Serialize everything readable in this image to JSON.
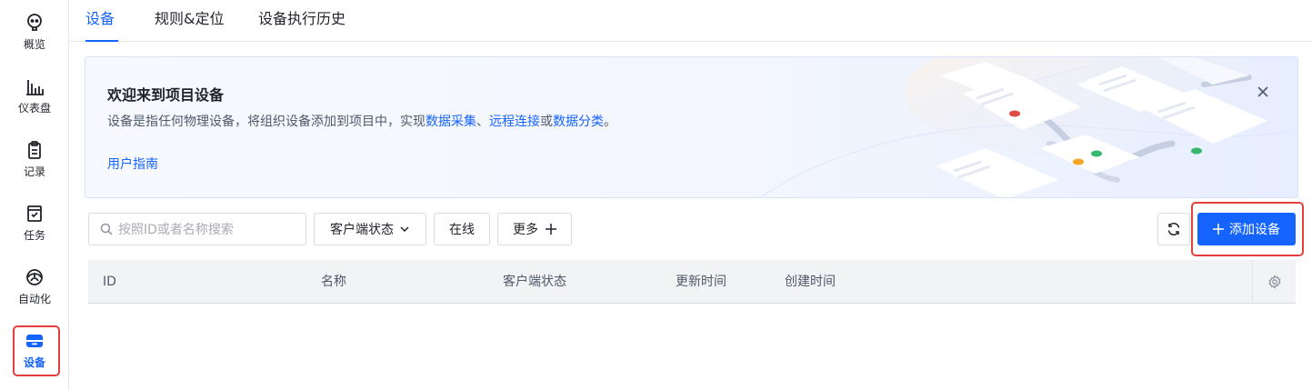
{
  "sidebar": {
    "items": [
      {
        "label": "概览",
        "icon": "bulb-icon"
      },
      {
        "label": "仪表盘",
        "icon": "bar-chart-icon"
      },
      {
        "label": "记录",
        "icon": "clipboard-icon"
      },
      {
        "label": "任务",
        "icon": "task-check-icon"
      },
      {
        "label": "自动化",
        "icon": "automation-icon"
      },
      {
        "label": "设备",
        "icon": "device-icon",
        "active": true
      }
    ]
  },
  "tabs": [
    {
      "label": "设备",
      "active": true
    },
    {
      "label": "规则&定位"
    },
    {
      "label": "设备执行历史"
    }
  ],
  "banner": {
    "title": "欢迎来到项目设备",
    "desc_prefix": "设备是指任何物理设备，将组织设备添加到项目中，实现",
    "link1": "数据采集",
    "sep1": "、",
    "link2": "远程连接",
    "sep2": "或",
    "link3": "数据分类",
    "suffix": "。",
    "guide": "用户指南"
  },
  "toolbar": {
    "search_placeholder": "按照ID或者名称搜索",
    "status_filter": "客户端状态",
    "online_filter": "在线",
    "more_filter": "更多",
    "add_button": "添加设备"
  },
  "table": {
    "columns": [
      "ID",
      "名称",
      "客户端状态",
      "更新时间",
      "创建时间"
    ]
  },
  "colors": {
    "accent": "#1664ff",
    "highlight_border": "#e53e3e"
  }
}
